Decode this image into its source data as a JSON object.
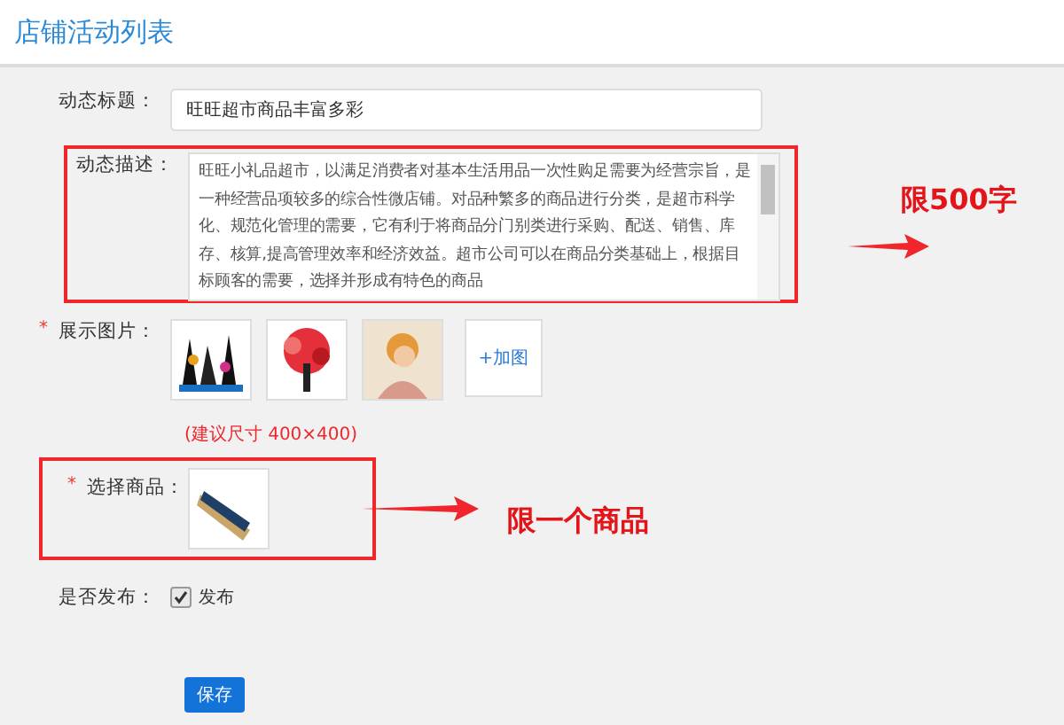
{
  "header": {
    "title": "店铺活动列表"
  },
  "form": {
    "title_field": {
      "label": "动态标题：",
      "value": "旺旺超市商品丰富多彩"
    },
    "description": {
      "label": "动态描述：",
      "value": "旺旺小礼品超市，以满足消费者对基本生活用品一次性购足需要为经营宗旨，是一种经营品项较多的综合性微店铺。对品种繁多的商品进行分类，是超市科学化、规范化管理的需要，它有利于将商品分门别类进行采购、配送、销售、库存、核算,提高管理效率和经济效益。超市公司可以在商品分类基础上，根据目标顾客的需要，选择并形成有特色的商品",
      "note": "限500字"
    },
    "images": {
      "label": "展示图片：",
      "required_mark": "*",
      "add_button": "+加图",
      "hint": "(建议尺寸 400×400)"
    },
    "product": {
      "label": "选择商品：",
      "required_mark": "*",
      "note": "限一个商品"
    },
    "publish": {
      "label": "是否发布：",
      "option": "发布",
      "checked": true
    },
    "save_button": "保存"
  }
}
